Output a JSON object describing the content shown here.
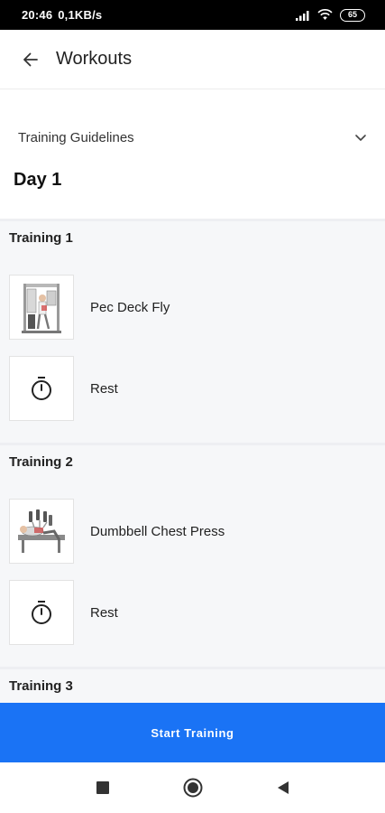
{
  "status_bar": {
    "time": "20:46",
    "speed": "0,1KB/s",
    "battery": "65"
  },
  "app_bar": {
    "title": "Workouts"
  },
  "guidelines": {
    "label": "Training Guidelines"
  },
  "day": {
    "title": "Day 1"
  },
  "sections": [
    {
      "title": "Training 1",
      "items": [
        {
          "label": "Pec Deck Fly",
          "icon": "pec-deck-machine-image"
        },
        {
          "label": "Rest",
          "icon": "timer-icon"
        }
      ]
    },
    {
      "title": "Training 2",
      "items": [
        {
          "label": "Dumbbell Chest Press",
          "icon": "dumbbell-press-image"
        },
        {
          "label": "Rest",
          "icon": "timer-icon"
        }
      ]
    },
    {
      "title": "Training 3",
      "items": []
    }
  ],
  "start_button": {
    "label": "Start Training"
  },
  "colors": {
    "accent": "#1a73f5",
    "section_bg": "#f6f7f9"
  }
}
